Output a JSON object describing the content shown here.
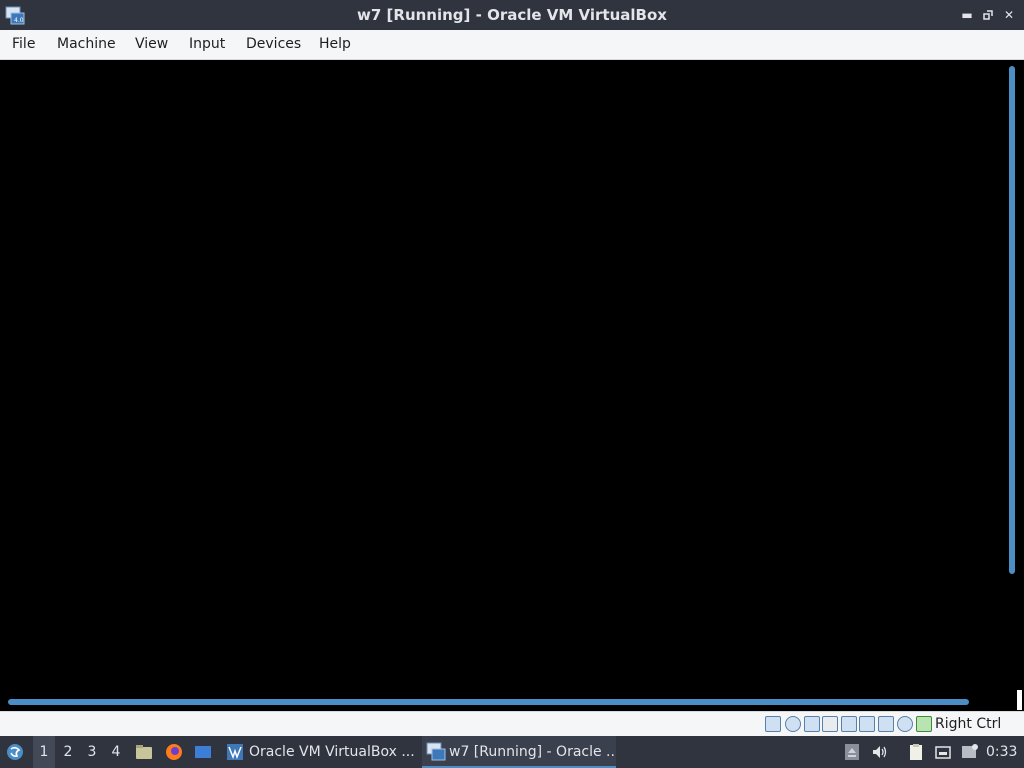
{
  "window": {
    "title": "w7 [Running] - Oracle VM VirtualBox",
    "controls": [
      "minimize-icon",
      "restore-icon",
      "close-icon"
    ]
  },
  "menu": {
    "items": [
      "File",
      "Machine",
      "View",
      "Input",
      "Devices",
      "Help"
    ]
  },
  "statusbar": {
    "icons": [
      "hard-disk-icon",
      "optical-disk-icon",
      "audio-icon",
      "network-icon",
      "usb-icon",
      "shared-folders-icon",
      "display-icon",
      "video-capture-icon",
      "virtualization-icon",
      "mouse-integration-icon",
      "keyboard-icon"
    ],
    "host_key": "Right Ctrl"
  },
  "taskbar": {
    "workspaces": [
      "1",
      "2",
      "3",
      "4"
    ],
    "active_workspace": "1",
    "tasks": [
      {
        "label": "Oracle VM VirtualBox ...",
        "active": false
      },
      {
        "label": "w7 [Running] - Oracle ...",
        "active": true
      }
    ],
    "clock": "0:33"
  },
  "colors": {
    "titlebar": "#2f343f",
    "accent": "#4b8ec6",
    "vm_screen": "#000000"
  }
}
